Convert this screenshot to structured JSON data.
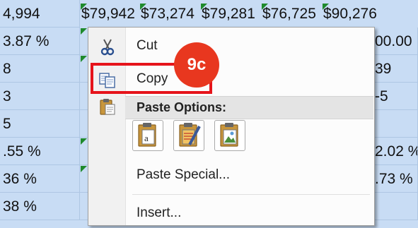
{
  "sheet": {
    "top_row": [
      "4,994",
      "$79,942",
      "$73,274",
      "$79,281",
      "$76,725",
      "$90,276"
    ],
    "left_column": [
      "3.87 %",
      "8",
      "3",
      "5",
      ".55 %",
      "36 %",
      "38 %"
    ],
    "right_column": [
      "00.00",
      "39",
      "-5",
      "",
      "2.02 %",
      ".73 %",
      ""
    ]
  },
  "menu": {
    "cut": {
      "label": "Cut",
      "icon": "scissors-icon"
    },
    "copy": {
      "label": "Copy",
      "icon": "copy-icon"
    },
    "paste_options": {
      "label": "Paste Options:",
      "icon": "clipboard-icon",
      "buttons": [
        "paste-keep-formatting-icon",
        "paste-formatting-icon",
        "paste-picture-icon"
      ]
    },
    "paste_special": {
      "label": "Paste Special..."
    },
    "insert": {
      "label": "Insert..."
    }
  },
  "callout": {
    "step": "9c",
    "color": "#e8371f",
    "highlight_color": "#e6141b"
  }
}
